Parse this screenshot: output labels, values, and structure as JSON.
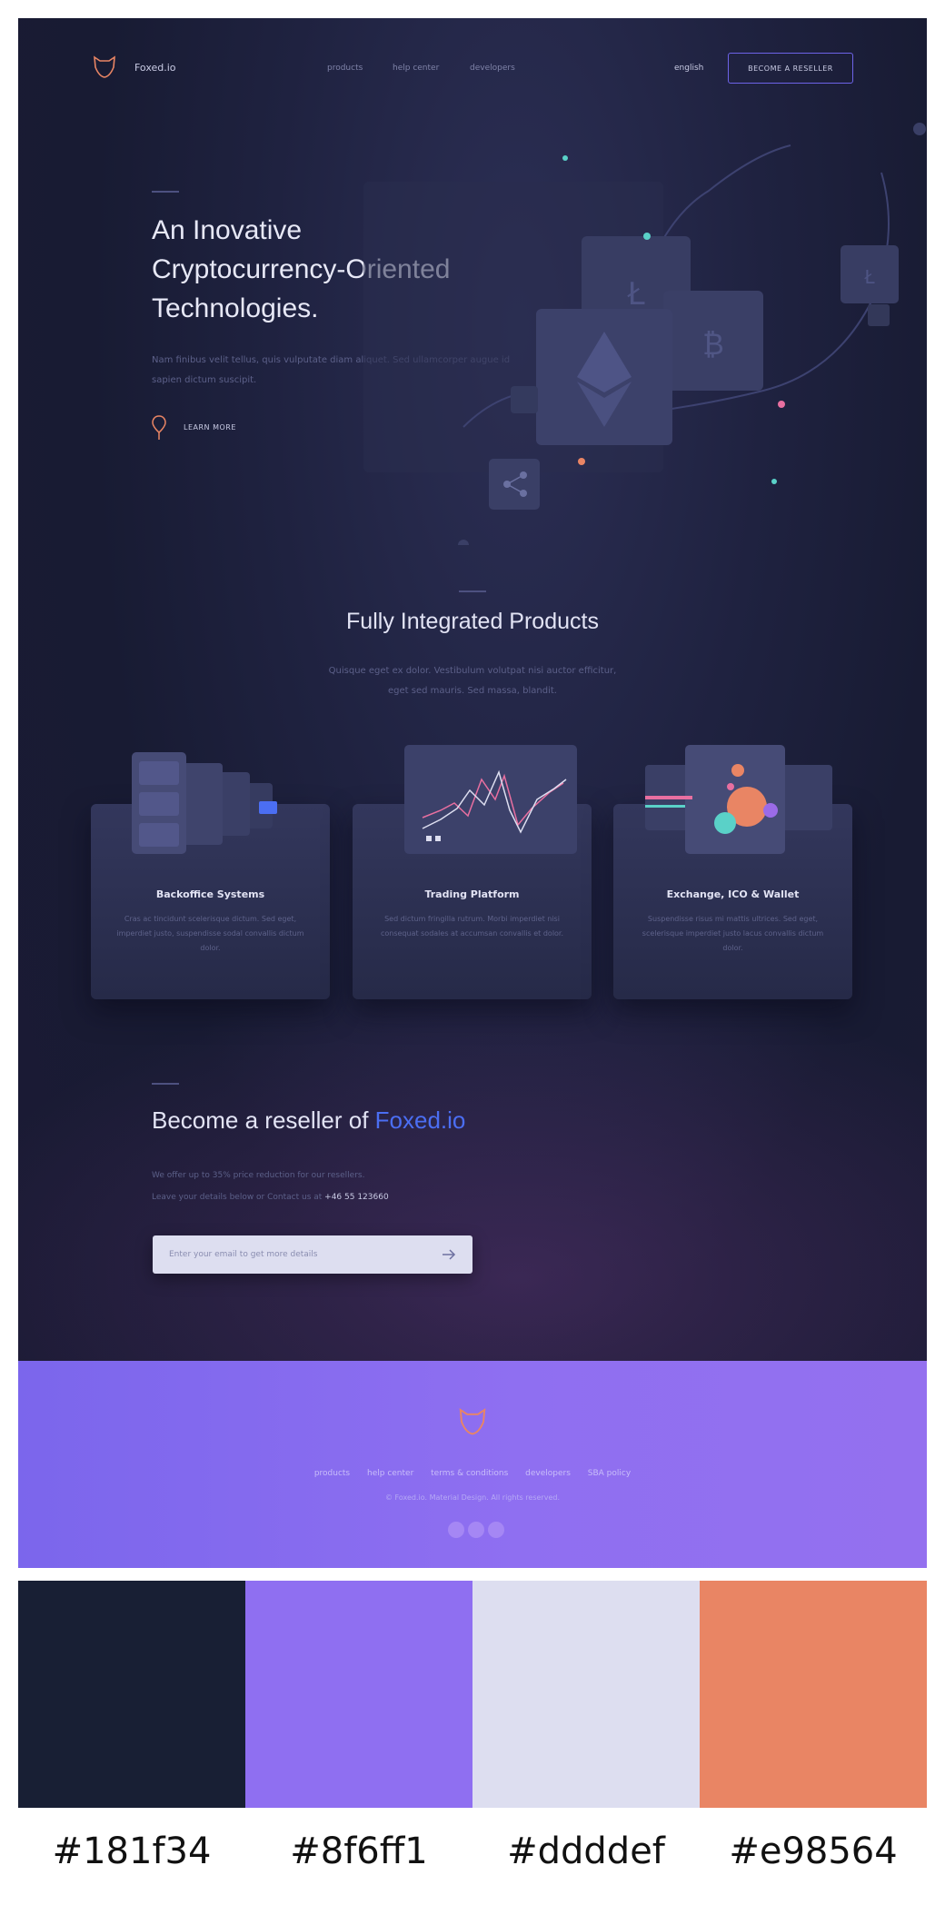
{
  "nav": {
    "brand": "Foxed.io",
    "links": [
      "products",
      "help center",
      "developers"
    ],
    "language": "english",
    "cta": "BECOME A RESELLER"
  },
  "hero": {
    "title_lines": [
      "An Inovative",
      "Cryptocurrency-Oriented",
      "Technologies."
    ],
    "text": "Nam finibus velit tellus, quis vulputate diam aliquet. Sed ullamcorper augue id sapien dictum suscipit.",
    "learn_more": "LEARN MORE"
  },
  "products": {
    "title": "Fully Integrated Products",
    "text": "Quisque eget ex dolor. Vestibulum volutpat nisi auctor efficitur, eget sed mauris. Sed massa, blandit.",
    "cards": [
      {
        "title": "Backoffice Systems",
        "text": "Cras ac tincidunt scelerisque dictum. Sed eget, imperdiet justo, suspendisse sodal convallis dictum dolor."
      },
      {
        "title": "Trading Platform",
        "text": "Sed dictum fringilla rutrum. Morbi imperdiet nisi consequat sodales at accumsan convallis et dolor."
      },
      {
        "title": "Exchange, ICO & Wallet",
        "text": "Suspendisse risus mi mattis ultrices. Sed eget, scelerisque imperdiet justo lacus convallis dictum dolor."
      }
    ]
  },
  "reseller": {
    "title_prefix": "Become a reseller of ",
    "title_accent": "Foxed.io",
    "text_line1": "We offer up to 35% price reduction for our resellers.",
    "text_line2_prefix": "Leave your details below or Contact us at ",
    "phone": "+46 55 123660",
    "email_placeholder": "Enter your email to get more details"
  },
  "footer": {
    "links": [
      "products",
      "help center",
      "terms & conditions",
      "developers",
      "SBA policy"
    ],
    "copyright": "© Foxed.io. Material Design. All rights reserved."
  },
  "palette": {
    "colors": [
      "#181f34",
      "#8f6ff1",
      "#dddef0",
      "#e98564"
    ],
    "labels": [
      "#181f34",
      "#8f6ff1",
      "#ddddef",
      "#e98564"
    ]
  },
  "icons": {
    "logo": "fox-shield-icon",
    "pin": "location-pin-icon",
    "arrow": "arrow-right-icon",
    "social": [
      "social-icon-1",
      "social-icon-2",
      "social-icon-3"
    ]
  }
}
